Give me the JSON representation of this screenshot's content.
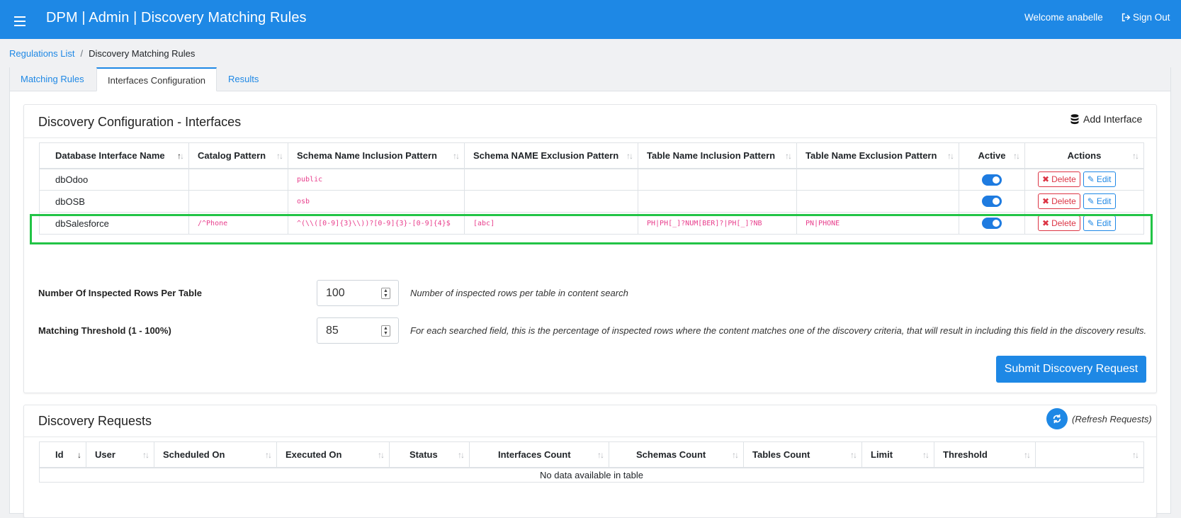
{
  "header": {
    "title": "DPM | Admin | Discovery Matching Rules",
    "welcome": "Welcome anabelle",
    "sign_out": "Sign Out"
  },
  "breadcrumb": {
    "parent": "Regulations List",
    "separator": "/",
    "current": "Discovery Matching Rules"
  },
  "tabs": [
    {
      "label": "Matching Rules",
      "active": false
    },
    {
      "label": "Interfaces Configuration",
      "active": true
    },
    {
      "label": "Results",
      "active": false
    }
  ],
  "config_card": {
    "title": "Discovery Configuration - Interfaces",
    "add_interface_label": "Add Interface",
    "columns": [
      "Database Interface Name",
      "Catalog Pattern",
      "Schema Name Inclusion Pattern",
      "Schema NAME Exclusion Pattern",
      "Table Name Inclusion Pattern",
      "Table Name Exclusion Pattern",
      "Active",
      "Actions"
    ],
    "rows": [
      {
        "name": "dbOdoo",
        "catalog": "",
        "schema_incl": "public",
        "schema_excl": "",
        "table_incl": "",
        "table_excl": "",
        "active": true
      },
      {
        "name": "dbOSB",
        "catalog": "",
        "schema_incl": "osb",
        "schema_excl": "",
        "table_incl": "",
        "table_excl": "",
        "active": true
      },
      {
        "name": "dbSalesforce",
        "catalog": "/^Phone",
        "schema_incl": "^(\\\\([0-9]{3}\\\\))?[0-9]{3}-[0-9]{4}$",
        "schema_excl": "[abc]",
        "table_incl": "PH|PH[_]?NUM[BER]?|PH[_]?NB",
        "table_excl": "PN|PHONE",
        "active": true
      }
    ],
    "delete_label": "Delete",
    "edit_label": "Edit",
    "inspected_rows": {
      "label": "Number Of Inspected Rows Per Table",
      "value": "100",
      "help": "Number of inspected rows per table in content search"
    },
    "threshold": {
      "label": "Matching Threshold (1 - 100%)",
      "value": "85",
      "help": "For each searched field, this is the percentage of inspected rows where the content matches one of the discovery criteria, that will result in including this field in the discovery results."
    },
    "submit_label": "Submit Discovery Request"
  },
  "requests_card": {
    "title": "Discovery Requests",
    "refresh_label": "(Refresh Requests)",
    "columns": [
      "Id",
      "User",
      "Scheduled On",
      "Executed On",
      "Status",
      "Interfaces Count",
      "Schemas Count",
      "Tables Count",
      "Limit",
      "Threshold",
      ""
    ],
    "empty_message": "No data available in table"
  },
  "colors": {
    "primary": "#1e88e5",
    "danger": "#dc3545",
    "highlight": "#22c446",
    "code": "#e83e8c"
  }
}
